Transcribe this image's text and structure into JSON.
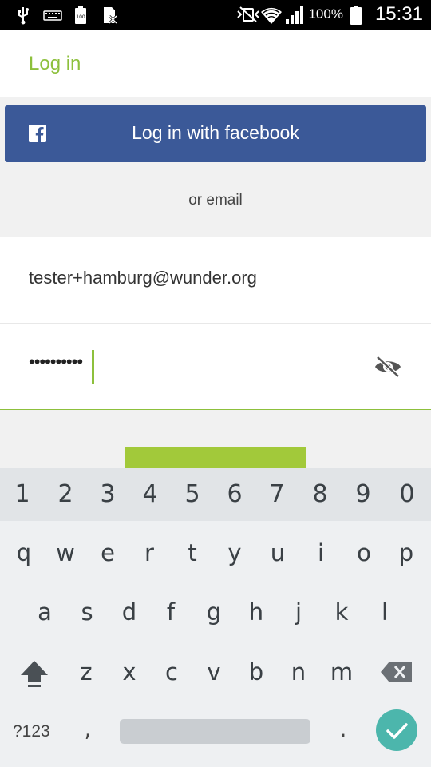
{
  "status_bar": {
    "battery_percent": "100%",
    "time": "15:31",
    "icons": [
      "usb-icon",
      "keyboard-icon",
      "battery-100-icon",
      "sim-off-icon",
      "vibrate-icon",
      "wifi-icon",
      "signal-icon",
      "battery-icon"
    ]
  },
  "header": {
    "title": "Log in"
  },
  "facebook_button": {
    "label": "Log in with facebook",
    "icon": "facebook-icon",
    "color": "#3b5998"
  },
  "divider_text": "or email",
  "email_field": {
    "value": "tester+hamburg@wunder.org"
  },
  "password_field": {
    "value": "••••••••••",
    "toggle_icon": "visibility-off-icon"
  },
  "accent_color": "#8dc03c",
  "keyboard": {
    "number_row": [
      "1",
      "2",
      "3",
      "4",
      "5",
      "6",
      "7",
      "8",
      "9",
      "0"
    ],
    "row1": [
      "q",
      "w",
      "e",
      "r",
      "t",
      "y",
      "u",
      "i",
      "o",
      "p"
    ],
    "row2": [
      "a",
      "s",
      "d",
      "f",
      "g",
      "h",
      "j",
      "k",
      "l"
    ],
    "row3": [
      "z",
      "x",
      "c",
      "v",
      "b",
      "n",
      "m"
    ],
    "symbols_key": "?123",
    "comma_key": ",",
    "period_key": ".",
    "shift_icon": "shift-icon",
    "backspace_icon": "backspace-icon",
    "done_icon": "check-icon"
  }
}
